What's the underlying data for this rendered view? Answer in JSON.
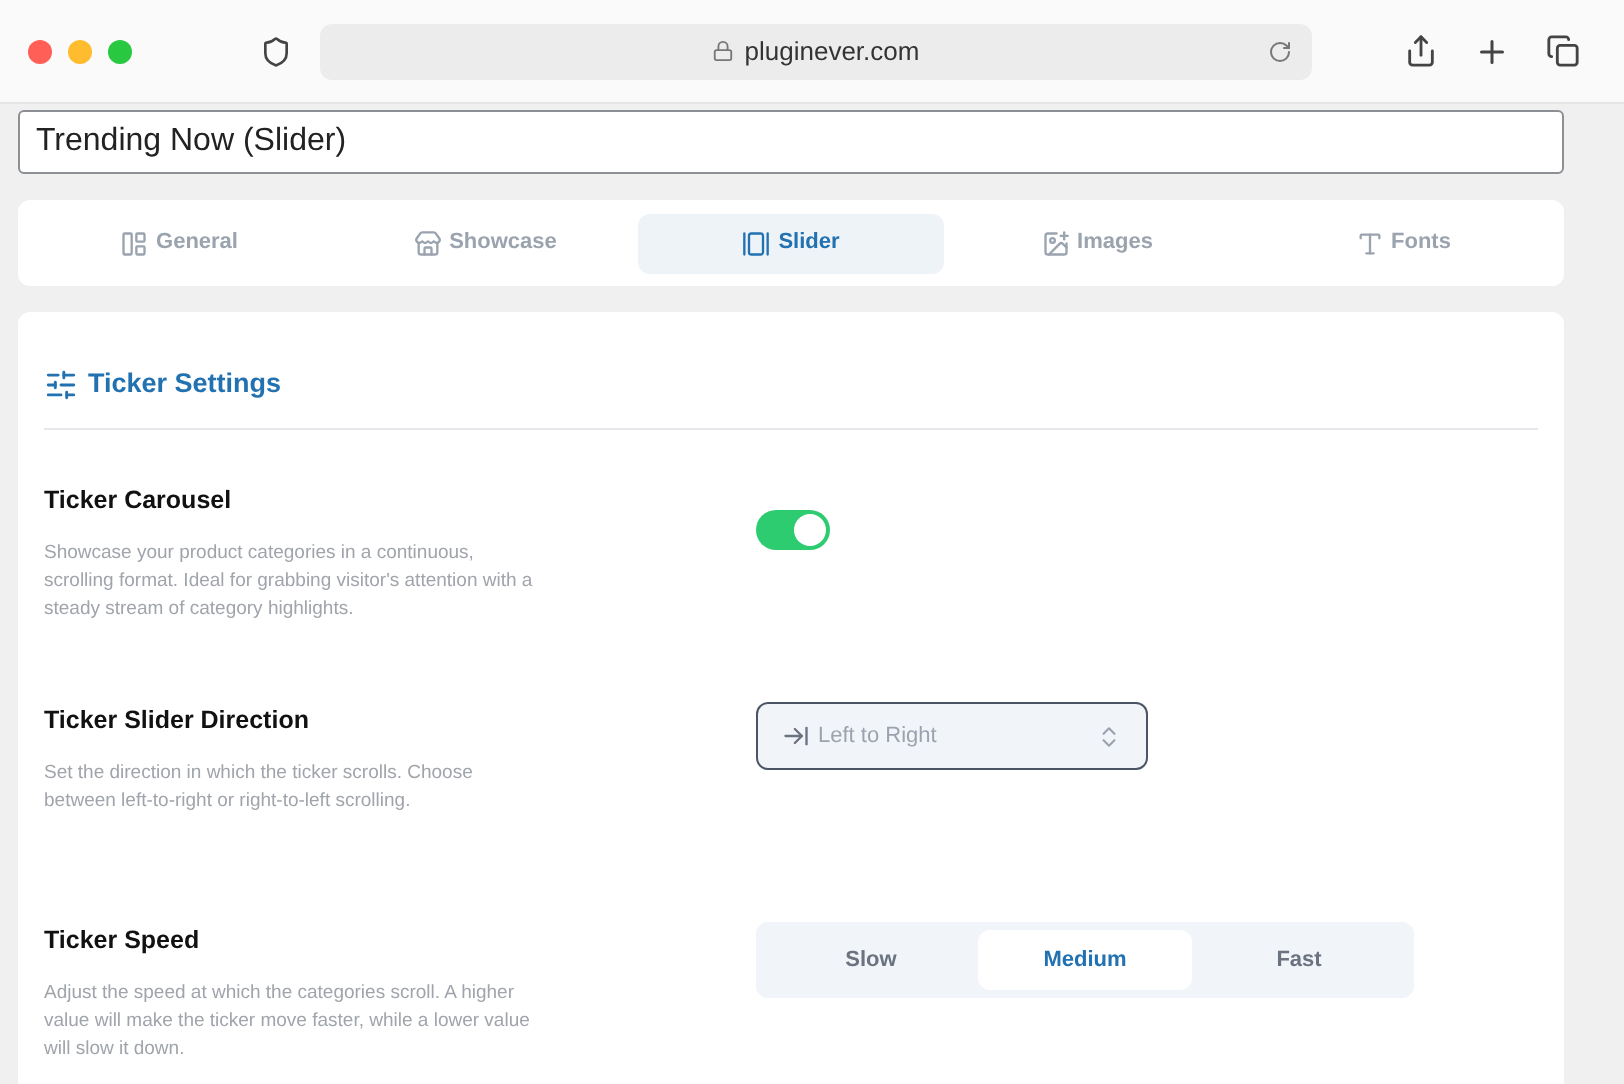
{
  "browser": {
    "url": "pluginever.com"
  },
  "title_field": {
    "value": "Trending Now (Slider)"
  },
  "tabs": [
    {
      "label": "General",
      "kind": "general",
      "selected": false
    },
    {
      "label": "Showcase",
      "kind": "showcase",
      "selected": false
    },
    {
      "label": "Slider",
      "kind": "slider",
      "selected": true
    },
    {
      "label": "Images",
      "kind": "images",
      "selected": false
    },
    {
      "label": "Fonts",
      "kind": "fonts",
      "selected": false
    }
  ],
  "section": {
    "title": "Ticker Settings"
  },
  "settings": [
    {
      "kind": "toggle",
      "label": "Ticker Carousel",
      "description": "Showcase your product categories in a continuous, scrolling format. Ideal for grabbing visitor's attention with a steady stream of category highlights.",
      "on": true
    },
    {
      "kind": "select",
      "label": "Ticker Slider Direction",
      "description": "Set the direction in which the ticker scrolls. Choose between left-to-right or right-to-left scrolling.",
      "value": "Left to Right"
    },
    {
      "kind": "segmented",
      "label": "Ticker Speed",
      "description": "Adjust the speed at which the categories scroll. A higher value will make the ticker move faster, while a lower value will slow it down.",
      "options": [
        {
          "label": "Slow",
          "selected": false
        },
        {
          "label": "Medium",
          "selected": true
        },
        {
          "label": "Fast",
          "selected": false
        }
      ]
    }
  ]
}
